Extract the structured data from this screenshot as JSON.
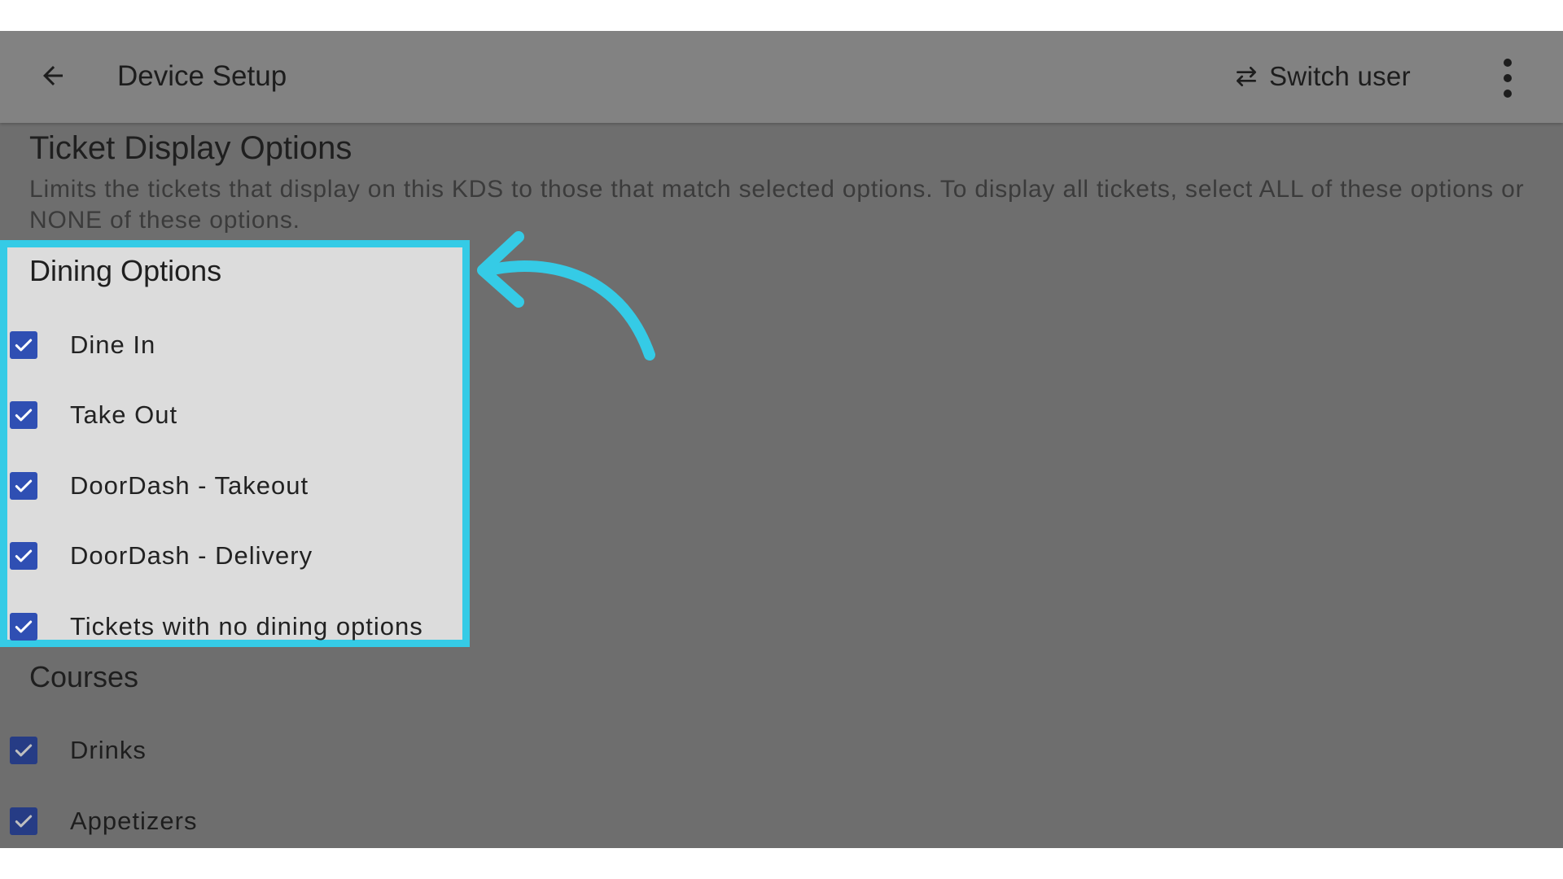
{
  "appbar": {
    "title": "Device Setup",
    "switch_user_label": "Switch user",
    "icons": {
      "back": "arrow-left-icon",
      "switch": "swap-horizontal-icon",
      "more": "more-vertical-icon"
    }
  },
  "section": {
    "title": "Ticket Display Options",
    "description": "Limits the tickets that display on this KDS to those that match selected options. To display all tickets, select ALL of these options or NONE of these options."
  },
  "dining_options": {
    "heading": "Dining Options",
    "items": [
      {
        "label": "Dine In",
        "checked": true
      },
      {
        "label": "Take Out",
        "checked": true
      },
      {
        "label": "DoorDash - Takeout",
        "checked": true
      },
      {
        "label": "DoorDash - Delivery",
        "checked": true
      },
      {
        "label": "Tickets with no dining options",
        "checked": true
      }
    ]
  },
  "courses": {
    "heading": "Courses",
    "items": [
      {
        "label": "Drinks",
        "checked": true
      },
      {
        "label": "Appetizers",
        "checked": true
      }
    ]
  },
  "colors": {
    "overlay_background": "#6e6e6e",
    "appbar_background": "#828282",
    "highlight_border": "#35cbe6",
    "highlight_fill": "#dcdcdc",
    "checkbox": "#2f4fb3",
    "annotation_arrow": "#35cbe6"
  }
}
